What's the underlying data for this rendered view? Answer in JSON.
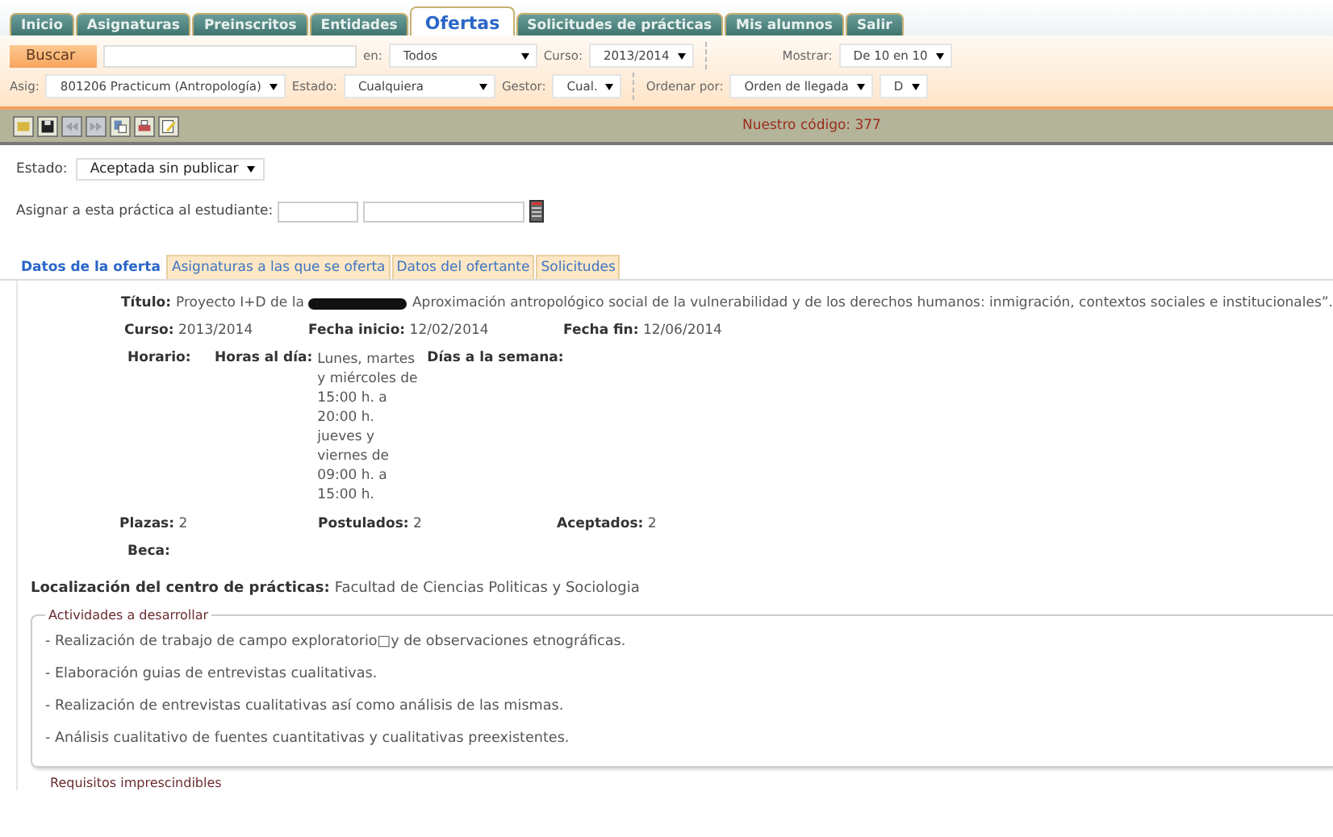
{
  "nav_tabs": [
    {
      "label": "Inicio",
      "selected": false
    },
    {
      "label": "Asignaturas",
      "selected": false
    },
    {
      "label": "Preinscritos",
      "selected": false
    },
    {
      "label": "Entidades",
      "selected": false
    },
    {
      "label": "Ofertas",
      "selected": true
    },
    {
      "label": "Solicitudes de prácticas",
      "selected": false
    },
    {
      "label": "Mis alumnos",
      "selected": false
    },
    {
      "label": "Salir",
      "selected": false
    }
  ],
  "filters": {
    "search_button": "Buscar",
    "in_label": "en:",
    "in_value": "Todos",
    "course_label": "Curso:",
    "course_value": "2013/2014",
    "show_label": "Mostrar:",
    "show_value": "De 10 en 10",
    "subject_label": "Asig:",
    "subject_value": "801206 Practicum (Antropología)",
    "state_label": "Estado:",
    "state_value": "Cualquiera",
    "manager_label": "Gestor:",
    "manager_value": "Cual.",
    "order_label": "Ordenar por:",
    "order_value": "Orden de llegada",
    "direction_value": "D"
  },
  "toolbar": {
    "buttons": [
      {
        "kind": "open",
        "disabled": false
      },
      {
        "kind": "save",
        "disabled": false
      },
      {
        "kind": "first",
        "disabled": true
      },
      {
        "kind": "last",
        "disabled": true
      },
      {
        "kind": "copy",
        "disabled": false
      },
      {
        "kind": "print",
        "disabled": false
      },
      {
        "kind": "edit",
        "disabled": false
      }
    ],
    "code": "Nuestro código: 377"
  },
  "status": {
    "label": "Estado:",
    "value": "Aceptada sin publicar"
  },
  "assign": {
    "label": "Asignar a esta práctica al estudiante:"
  },
  "detail_tabs": [
    {
      "label": "Datos de la oferta",
      "selected": true
    },
    {
      "label": "Asignaturas a las que se oferta",
      "selected": false
    },
    {
      "label": "Datos del ofertante",
      "selected": false
    },
    {
      "label": "Solicitudes",
      "selected": false
    }
  ],
  "offer": {
    "title_label": "Título:",
    "title_start": "Proyecto I+D de la",
    "title_redacted": true,
    "title_rest": "Aproximación antropológico social de la vulnerabilidad y de los derechos humanos: inmigración, contextos sociales e institucionales”.",
    "course_label": "Curso:",
    "course": "2013/2014",
    "start_label": "Fecha inicio:",
    "start": "12/02/2014",
    "end_label": "Fecha fin:",
    "end": "12/06/2014",
    "schedule_label": "Horario:",
    "hours_label": "Horas al día:",
    "hours": "Lunes, martes y miércoles de 15:00 h. a 20:00 h. jueves y viernes de 09:00 h. a 15:00 h.",
    "days_label": "Días a la semana:",
    "places_label": "Plazas:",
    "places": "2",
    "applied_label": "Postulados:",
    "applied": "2",
    "accepted_label": "Aceptados:",
    "accepted": "2",
    "grant_label": "Beca:",
    "location_label": "Localización del centro de prácticas:",
    "location": "Facultad de Ciencias Politicas y Sociologia",
    "activities_legend": "Actividades a desarrollar",
    "activities": [
      "- Realización de trabajo de campo exploratorio□y de observaciones etnográficas.",
      "- Elaboración guias de entrevistas cualitativas.",
      "- Realización de entrevistas cualitativas así como análisis de las mismas.",
      "- Análisis cualitativo de fuentes cuantitativas y cualitativas preexistentes."
    ],
    "requirements_legend": "Requisitos imprescindibles"
  }
}
